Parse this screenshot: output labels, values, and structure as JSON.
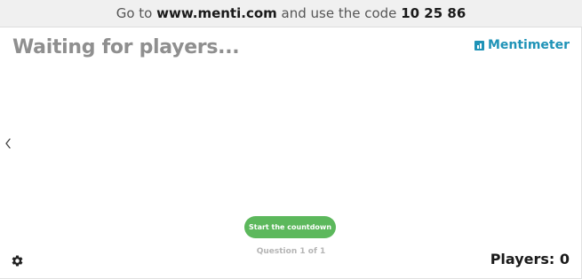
{
  "banner": {
    "prefix": "Go to ",
    "url": "www.menti.com",
    "middle": " and use the code ",
    "code": "10 25 86"
  },
  "title": "Waiting for players...",
  "logo": {
    "text": "Mentimeter",
    "icon": "mentimeter-logo-icon",
    "color": "#1f93b7"
  },
  "nav": {
    "prev_icon": "chevron-left-icon"
  },
  "start_button": {
    "label": "Start the countdown",
    "color": "#5cb85c"
  },
  "question_counter": "Question 1 of 1",
  "settings": {
    "icon": "gear-icon"
  },
  "players": {
    "label": "Players: 0"
  }
}
